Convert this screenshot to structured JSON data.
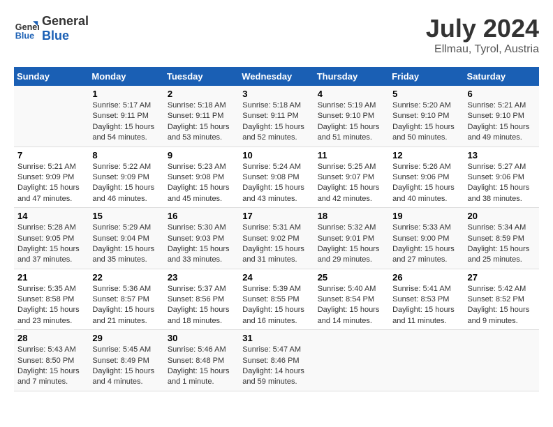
{
  "header": {
    "logo_line1": "General",
    "logo_line2": "Blue",
    "month_year": "July 2024",
    "location": "Ellmau, Tyrol, Austria"
  },
  "weekdays": [
    "Sunday",
    "Monday",
    "Tuesday",
    "Wednesday",
    "Thursday",
    "Friday",
    "Saturday"
  ],
  "weeks": [
    [
      {
        "day": "",
        "info": ""
      },
      {
        "day": "1",
        "info": "Sunrise: 5:17 AM\nSunset: 9:11 PM\nDaylight: 15 hours\nand 54 minutes."
      },
      {
        "day": "2",
        "info": "Sunrise: 5:18 AM\nSunset: 9:11 PM\nDaylight: 15 hours\nand 53 minutes."
      },
      {
        "day": "3",
        "info": "Sunrise: 5:18 AM\nSunset: 9:11 PM\nDaylight: 15 hours\nand 52 minutes."
      },
      {
        "day": "4",
        "info": "Sunrise: 5:19 AM\nSunset: 9:10 PM\nDaylight: 15 hours\nand 51 minutes."
      },
      {
        "day": "5",
        "info": "Sunrise: 5:20 AM\nSunset: 9:10 PM\nDaylight: 15 hours\nand 50 minutes."
      },
      {
        "day": "6",
        "info": "Sunrise: 5:21 AM\nSunset: 9:10 PM\nDaylight: 15 hours\nand 49 minutes."
      }
    ],
    [
      {
        "day": "7",
        "info": "Sunrise: 5:21 AM\nSunset: 9:09 PM\nDaylight: 15 hours\nand 47 minutes."
      },
      {
        "day": "8",
        "info": "Sunrise: 5:22 AM\nSunset: 9:09 PM\nDaylight: 15 hours\nand 46 minutes."
      },
      {
        "day": "9",
        "info": "Sunrise: 5:23 AM\nSunset: 9:08 PM\nDaylight: 15 hours\nand 45 minutes."
      },
      {
        "day": "10",
        "info": "Sunrise: 5:24 AM\nSunset: 9:08 PM\nDaylight: 15 hours\nand 43 minutes."
      },
      {
        "day": "11",
        "info": "Sunrise: 5:25 AM\nSunset: 9:07 PM\nDaylight: 15 hours\nand 42 minutes."
      },
      {
        "day": "12",
        "info": "Sunrise: 5:26 AM\nSunset: 9:06 PM\nDaylight: 15 hours\nand 40 minutes."
      },
      {
        "day": "13",
        "info": "Sunrise: 5:27 AM\nSunset: 9:06 PM\nDaylight: 15 hours\nand 38 minutes."
      }
    ],
    [
      {
        "day": "14",
        "info": "Sunrise: 5:28 AM\nSunset: 9:05 PM\nDaylight: 15 hours\nand 37 minutes."
      },
      {
        "day": "15",
        "info": "Sunrise: 5:29 AM\nSunset: 9:04 PM\nDaylight: 15 hours\nand 35 minutes."
      },
      {
        "day": "16",
        "info": "Sunrise: 5:30 AM\nSunset: 9:03 PM\nDaylight: 15 hours\nand 33 minutes."
      },
      {
        "day": "17",
        "info": "Sunrise: 5:31 AM\nSunset: 9:02 PM\nDaylight: 15 hours\nand 31 minutes."
      },
      {
        "day": "18",
        "info": "Sunrise: 5:32 AM\nSunset: 9:01 PM\nDaylight: 15 hours\nand 29 minutes."
      },
      {
        "day": "19",
        "info": "Sunrise: 5:33 AM\nSunset: 9:00 PM\nDaylight: 15 hours\nand 27 minutes."
      },
      {
        "day": "20",
        "info": "Sunrise: 5:34 AM\nSunset: 8:59 PM\nDaylight: 15 hours\nand 25 minutes."
      }
    ],
    [
      {
        "day": "21",
        "info": "Sunrise: 5:35 AM\nSunset: 8:58 PM\nDaylight: 15 hours\nand 23 minutes."
      },
      {
        "day": "22",
        "info": "Sunrise: 5:36 AM\nSunset: 8:57 PM\nDaylight: 15 hours\nand 21 minutes."
      },
      {
        "day": "23",
        "info": "Sunrise: 5:37 AM\nSunset: 8:56 PM\nDaylight: 15 hours\nand 18 minutes."
      },
      {
        "day": "24",
        "info": "Sunrise: 5:39 AM\nSunset: 8:55 PM\nDaylight: 15 hours\nand 16 minutes."
      },
      {
        "day": "25",
        "info": "Sunrise: 5:40 AM\nSunset: 8:54 PM\nDaylight: 15 hours\nand 14 minutes."
      },
      {
        "day": "26",
        "info": "Sunrise: 5:41 AM\nSunset: 8:53 PM\nDaylight: 15 hours\nand 11 minutes."
      },
      {
        "day": "27",
        "info": "Sunrise: 5:42 AM\nSunset: 8:52 PM\nDaylight: 15 hours\nand 9 minutes."
      }
    ],
    [
      {
        "day": "28",
        "info": "Sunrise: 5:43 AM\nSunset: 8:50 PM\nDaylight: 15 hours\nand 7 minutes."
      },
      {
        "day": "29",
        "info": "Sunrise: 5:45 AM\nSunset: 8:49 PM\nDaylight: 15 hours\nand 4 minutes."
      },
      {
        "day": "30",
        "info": "Sunrise: 5:46 AM\nSunset: 8:48 PM\nDaylight: 15 hours\nand 1 minute."
      },
      {
        "day": "31",
        "info": "Sunrise: 5:47 AM\nSunset: 8:46 PM\nDaylight: 14 hours\nand 59 minutes."
      },
      {
        "day": "",
        "info": ""
      },
      {
        "day": "",
        "info": ""
      },
      {
        "day": "",
        "info": ""
      }
    ]
  ]
}
